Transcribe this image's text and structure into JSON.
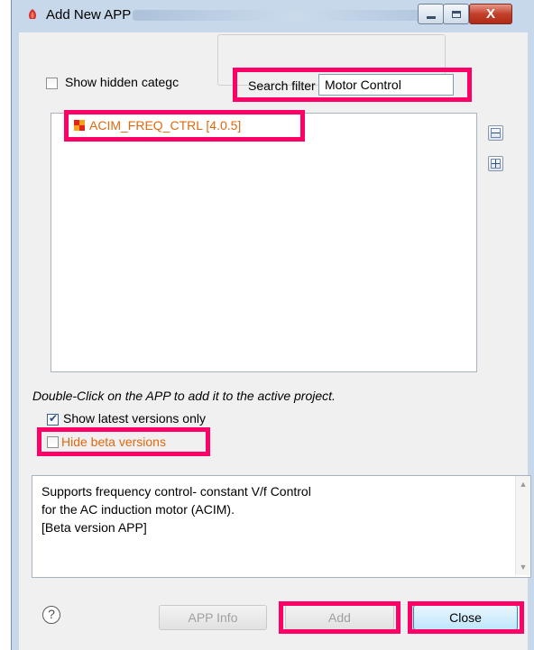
{
  "window": {
    "title": "Add New APP",
    "controls": {
      "minimize": "minimize",
      "maximize": "maximize",
      "close": "X"
    }
  },
  "filters": {
    "show_hidden_label": "Show hidden categc",
    "show_hidden_checked": false,
    "search_label": "Search filter",
    "search_value": "Motor Control"
  },
  "app_list": {
    "items": [
      {
        "label": "ACIM_FREQ_CTRL [4.0.5]",
        "icon": "app-package-icon"
      }
    ]
  },
  "tree_controls": {
    "collapse": "collapse-all-icon",
    "expand": "expand-all-icon"
  },
  "hint": "Double-Click on the APP to add it to the active project.",
  "options": {
    "latest_label": "Show latest versions only",
    "latest_checked": true,
    "beta_label": "Hide beta versions",
    "beta_checked": false
  },
  "description": {
    "lines": [
      "Supports frequency control- constant V/f Control",
      "for the AC induction motor (ACIM).",
      "[Beta version APP]"
    ]
  },
  "buttons": {
    "help": "?",
    "app_info": "APP Info",
    "add": "Add",
    "close": "Close"
  },
  "colors": {
    "highlight": "#ff0066",
    "app_label": "#e0680e",
    "title_bar": "#c7d8ea"
  }
}
